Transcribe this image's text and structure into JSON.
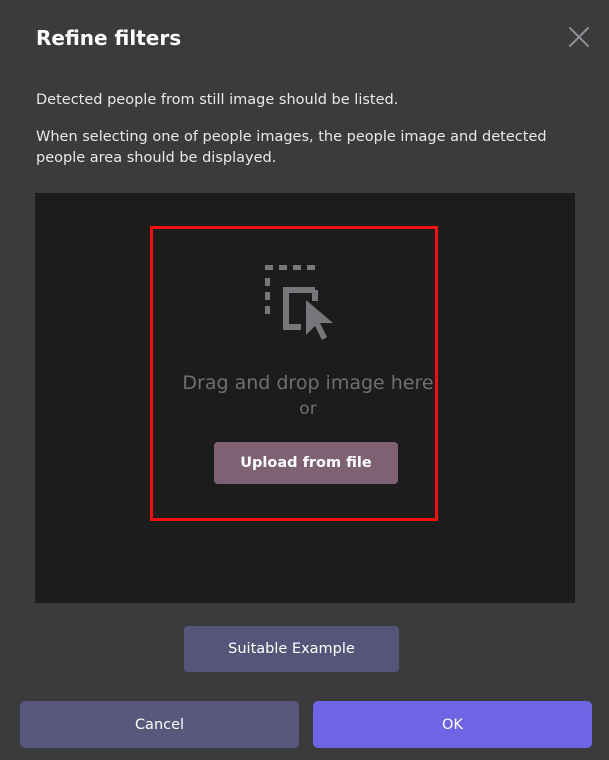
{
  "dialog": {
    "title": "Refine filters",
    "close_icon": "close-icon",
    "description_1": "Detected people from still image should be listed.",
    "description_2": "When selecting one of people images, the people image and detected people area should be displayed."
  },
  "dropzone": {
    "icon": "drag-drop-selection-icon",
    "drag_text": "Drag and drop image here",
    "or_text": "or",
    "upload_label": "Upload from file",
    "highlight_color": "#f10f0f"
  },
  "actions": {
    "example_label": "Suitable Example",
    "cancel_label": "Cancel",
    "ok_label": "OK"
  },
  "colors": {
    "background": "#3b3b3d",
    "dropzone": "#1c1c1d",
    "upload_button": "#7e6274",
    "secondary_button": "#58587d",
    "primary_button": "#6f65e4"
  }
}
